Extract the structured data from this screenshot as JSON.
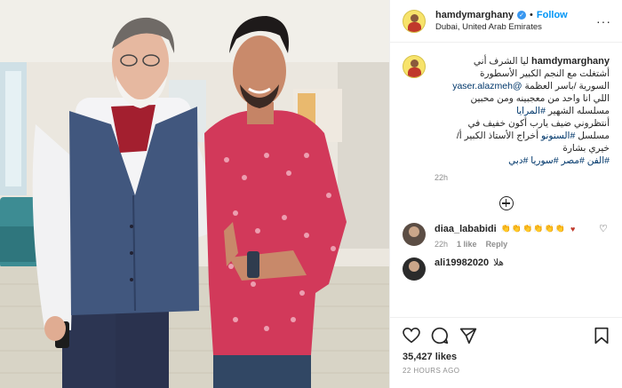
{
  "post": {
    "author": {
      "username": "hamdymarghany",
      "location": "Dubai, United Arab Emirates",
      "follow_label": "Follow",
      "separator": "•"
    },
    "caption": {
      "username": "hamdymarghany",
      "line1": "ليا الشرف أني",
      "line2": "أشتغلت مع النجم الكبير الأسطورة",
      "line3_text": "السورية /باسر العظمة",
      "line3_mention": "@yaser.alazmeh",
      "line4": "اللي انا واحد من معجبينه ومن محبين",
      "line5_text": "مسلسله الشهير",
      "line5_tag": "#المرايا",
      "line6": "أنتظروني ضيف يارب أكون خفيف في",
      "line7_text": "مسلسل",
      "line7_tag": "#السنونو",
      "line7_rest": "أخراج الأستاذ الكبير أ/",
      "line8": "خيري بشارة",
      "line9_tags": "#الفن #مصر #سوريا #دبي",
      "time": "22h"
    },
    "comments": [
      {
        "username": "diaa_lababidi",
        "emoji_hands": "👏👏👏👏👏👏",
        "emoji_heart": "♥",
        "time": "22h",
        "likes": "1 like",
        "reply": "Reply"
      },
      {
        "username": "ali19982020",
        "text": "هلا"
      }
    ],
    "likes": "35,427 likes",
    "posted": "22 HOURS AGO",
    "more_icon": "more-horizontal-icon"
  }
}
